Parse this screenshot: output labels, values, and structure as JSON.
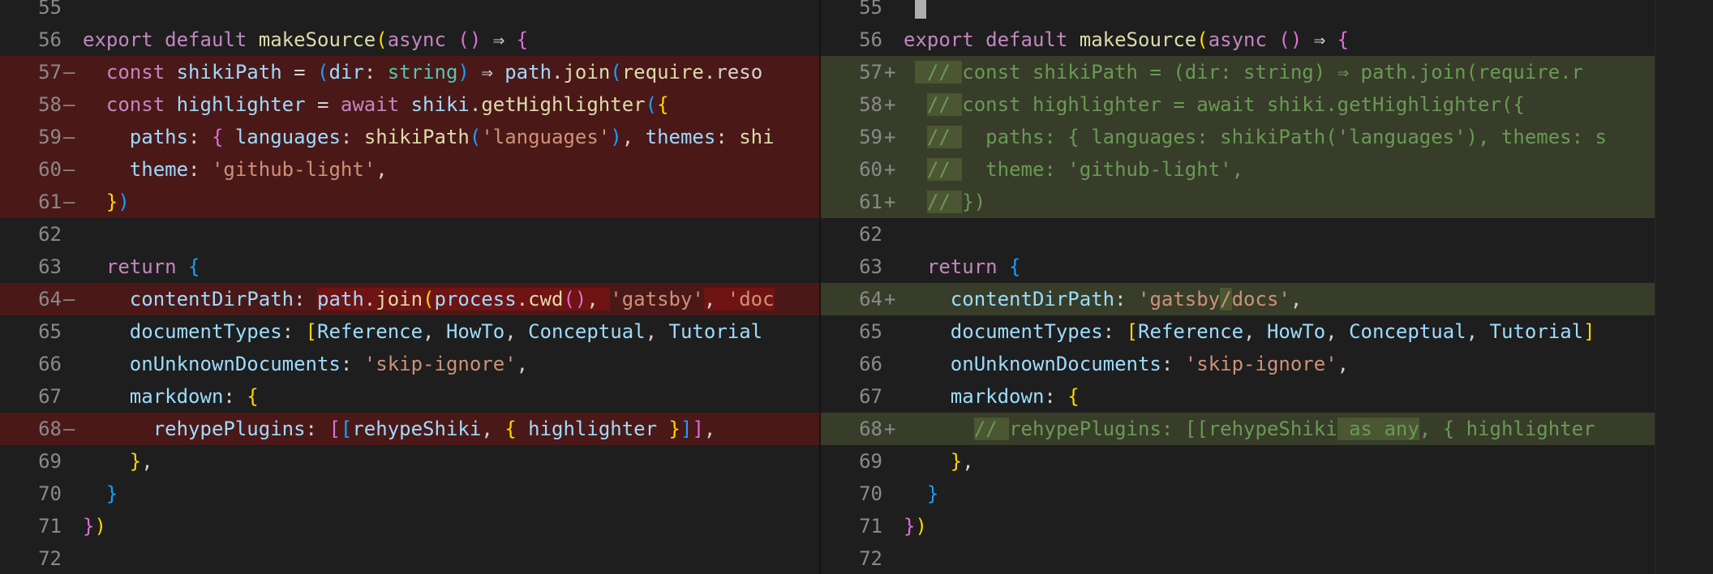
{
  "left": {
    "lines": [
      {
        "num": "55",
        "marker": "",
        "tokens": []
      },
      {
        "num": "56",
        "marker": "",
        "tokens": [
          {
            "t": "export default ",
            "c": "k"
          },
          {
            "t": "makeSource",
            "c": "f"
          },
          {
            "t": "(",
            "c": "b1"
          },
          {
            "t": "async ",
            "c": "k"
          },
          {
            "t": "()",
            "c": "b2"
          },
          {
            "t": " ⇒ ",
            "c": "p"
          },
          {
            "t": "{",
            "c": "b2"
          }
        ]
      },
      {
        "num": "57",
        "marker": "—",
        "type": "removed",
        "tokens": [
          {
            "t": "  const ",
            "c": "k"
          },
          {
            "t": "shikiPath",
            "c": "v"
          },
          {
            "t": " = ",
            "c": "p"
          },
          {
            "t": "(",
            "c": "b3"
          },
          {
            "t": "dir",
            "c": "v"
          },
          {
            "t": ": ",
            "c": "p"
          },
          {
            "t": "string",
            "c": "t"
          },
          {
            "t": ")",
            "c": "b3"
          },
          {
            "t": " ⇒ ",
            "c": "p"
          },
          {
            "t": "path",
            "c": "v"
          },
          {
            "t": ".",
            "c": "p"
          },
          {
            "t": "join",
            "c": "f"
          },
          {
            "t": "(",
            "c": "b3"
          },
          {
            "t": "require",
            "c": "f"
          },
          {
            "t": ".reso",
            "c": "p"
          }
        ]
      },
      {
        "num": "58",
        "marker": "—",
        "type": "removed",
        "tokens": [
          {
            "t": "  const ",
            "c": "k"
          },
          {
            "t": "highlighter",
            "c": "v"
          },
          {
            "t": " = ",
            "c": "p"
          },
          {
            "t": "await ",
            "c": "k"
          },
          {
            "t": "shiki",
            "c": "v"
          },
          {
            "t": ".",
            "c": "p"
          },
          {
            "t": "getHighlighter",
            "c": "f"
          },
          {
            "t": "(",
            "c": "b3"
          },
          {
            "t": "{",
            "c": "b1"
          }
        ]
      },
      {
        "num": "59",
        "marker": "—",
        "type": "removed",
        "tokens": [
          {
            "t": "    paths",
            "c": "v"
          },
          {
            "t": ": ",
            "c": "p"
          },
          {
            "t": "{ ",
            "c": "b2"
          },
          {
            "t": "languages",
            "c": "v"
          },
          {
            "t": ": ",
            "c": "p"
          },
          {
            "t": "shikiPath",
            "c": "f"
          },
          {
            "t": "(",
            "c": "b3"
          },
          {
            "t": "'languages'",
            "c": "s"
          },
          {
            "t": ")",
            "c": "b3"
          },
          {
            "t": ", ",
            "c": "p"
          },
          {
            "t": "themes",
            "c": "v"
          },
          {
            "t": ": ",
            "c": "p"
          },
          {
            "t": "shi",
            "c": "f"
          }
        ]
      },
      {
        "num": "60",
        "marker": "—",
        "type": "removed",
        "tokens": [
          {
            "t": "    theme",
            "c": "v"
          },
          {
            "t": ": ",
            "c": "p"
          },
          {
            "t": "'github-light'",
            "c": "s"
          },
          {
            "t": ",",
            "c": "p"
          }
        ]
      },
      {
        "num": "61",
        "marker": "—",
        "type": "removed",
        "tokens": [
          {
            "t": "  }",
            "c": "b1"
          },
          {
            "t": ")",
            "c": "b3"
          }
        ]
      },
      {
        "num": "62",
        "marker": "",
        "tokens": []
      },
      {
        "num": "63",
        "marker": "",
        "tokens": [
          {
            "t": "  return ",
            "c": "k"
          },
          {
            "t": "{",
            "c": "b3"
          }
        ]
      },
      {
        "num": "64",
        "marker": "—",
        "type": "removed",
        "tokens": [
          {
            "t": "    contentDirPath",
            "c": "v"
          },
          {
            "t": ": ",
            "c": "p"
          },
          {
            "t": "path",
            "c": "v",
            "h": 1
          },
          {
            "t": ".",
            "c": "p",
            "h": 1
          },
          {
            "t": "join",
            "c": "f",
            "h": 1
          },
          {
            "t": "(",
            "c": "b1",
            "h": 1
          },
          {
            "t": "process",
            "c": "v",
            "h": 1
          },
          {
            "t": ".",
            "c": "p",
            "h": 1
          },
          {
            "t": "cwd",
            "c": "f",
            "h": 1
          },
          {
            "t": "()",
            "c": "b2",
            "h": 1
          },
          {
            "t": ", ",
            "c": "p",
            "h": 1
          },
          {
            "t": "'gatsby'",
            "c": "s"
          },
          {
            "t": ", ",
            "c": "p",
            "h": 1
          },
          {
            "t": "'doc",
            "c": "s",
            "h": 1
          }
        ]
      },
      {
        "num": "65",
        "marker": "",
        "tokens": [
          {
            "t": "    documentTypes",
            "c": "v"
          },
          {
            "t": ": ",
            "c": "p"
          },
          {
            "t": "[",
            "c": "b1"
          },
          {
            "t": "Reference",
            "c": "v"
          },
          {
            "t": ", ",
            "c": "p"
          },
          {
            "t": "HowTo",
            "c": "v"
          },
          {
            "t": ", ",
            "c": "p"
          },
          {
            "t": "Conceptual",
            "c": "v"
          },
          {
            "t": ", ",
            "c": "p"
          },
          {
            "t": "Tutorial",
            "c": "v"
          }
        ]
      },
      {
        "num": "66",
        "marker": "",
        "tokens": [
          {
            "t": "    onUnknownDocuments",
            "c": "v"
          },
          {
            "t": ": ",
            "c": "p"
          },
          {
            "t": "'skip-ignore'",
            "c": "s"
          },
          {
            "t": ",",
            "c": "p"
          }
        ]
      },
      {
        "num": "67",
        "marker": "",
        "tokens": [
          {
            "t": "    markdown",
            "c": "v"
          },
          {
            "t": ": ",
            "c": "p"
          },
          {
            "t": "{",
            "c": "b1"
          }
        ]
      },
      {
        "num": "68",
        "marker": "—",
        "type": "removed",
        "tokens": [
          {
            "t": "      rehypePlugins",
            "c": "v"
          },
          {
            "t": ": ",
            "c": "p"
          },
          {
            "t": "[",
            "c": "b2"
          },
          {
            "t": "[",
            "c": "b3"
          },
          {
            "t": "rehypeShiki",
            "c": "v"
          },
          {
            "t": ", ",
            "c": "p"
          },
          {
            "t": "{ ",
            "c": "b1"
          },
          {
            "t": "highlighter",
            "c": "v"
          },
          {
            "t": " }",
            "c": "b1"
          },
          {
            "t": "]",
            "c": "b3"
          },
          {
            "t": "]",
            "c": "b2"
          },
          {
            "t": ",",
            "c": "p"
          }
        ]
      },
      {
        "num": "69",
        "marker": "",
        "tokens": [
          {
            "t": "    }",
            "c": "b1"
          },
          {
            "t": ",",
            "c": "p"
          }
        ]
      },
      {
        "num": "70",
        "marker": "",
        "tokens": [
          {
            "t": "  }",
            "c": "b3"
          }
        ]
      },
      {
        "num": "71",
        "marker": "",
        "tokens": [
          {
            "t": "}",
            "c": "b2"
          },
          {
            "t": ")",
            "c": "b1"
          }
        ]
      },
      {
        "num": "72",
        "marker": "",
        "tokens": []
      }
    ]
  },
  "right": {
    "lines": [
      {
        "num": "55",
        "marker": "",
        "cursor": true,
        "tokens": []
      },
      {
        "num": "56",
        "marker": "",
        "tokens": [
          {
            "t": "export default ",
            "c": "k"
          },
          {
            "t": "makeSource",
            "c": "f"
          },
          {
            "t": "(",
            "c": "b1"
          },
          {
            "t": "async ",
            "c": "k"
          },
          {
            "t": "()",
            "c": "b2"
          },
          {
            "t": " ⇒ ",
            "c": "p"
          },
          {
            "t": "{",
            "c": "b2"
          }
        ]
      },
      {
        "num": "57",
        "marker": "+",
        "type": "added",
        "tokens": [
          {
            "t": " ",
            "c": "p"
          },
          {
            "t": " // ",
            "c": "c",
            "h": 1
          },
          {
            "t": "const shikiPath = (dir: string) ⇒ path.join(require.r",
            "c": "c"
          }
        ]
      },
      {
        "num": "58",
        "marker": "+",
        "type": "added",
        "tokens": [
          {
            "t": "  ",
            "c": "p"
          },
          {
            "t": "// ",
            "c": "c",
            "h": 1
          },
          {
            "t": "const highlighter = await shiki.getHighlighter({",
            "c": "c"
          }
        ]
      },
      {
        "num": "59",
        "marker": "+",
        "type": "added",
        "tokens": [
          {
            "t": "  ",
            "c": "p"
          },
          {
            "t": "// ",
            "c": "c",
            "h": 1
          },
          {
            "t": "  paths: { languages: shikiPath('languages'), themes: s",
            "c": "c"
          }
        ]
      },
      {
        "num": "60",
        "marker": "+",
        "type": "added",
        "tokens": [
          {
            "t": "  ",
            "c": "p"
          },
          {
            "t": "// ",
            "c": "c",
            "h": 1
          },
          {
            "t": "  theme: 'github-light',",
            "c": "c"
          }
        ]
      },
      {
        "num": "61",
        "marker": "+",
        "type": "added",
        "tokens": [
          {
            "t": "  ",
            "c": "p"
          },
          {
            "t": "// ",
            "c": "c",
            "h": 1
          },
          {
            "t": "})",
            "c": "c"
          }
        ]
      },
      {
        "num": "62",
        "marker": "",
        "tokens": []
      },
      {
        "num": "63",
        "marker": "",
        "tokens": [
          {
            "t": "  return ",
            "c": "k"
          },
          {
            "t": "{",
            "c": "b3"
          }
        ]
      },
      {
        "num": "64",
        "marker": "+",
        "type": "added",
        "tokens": [
          {
            "t": "    contentDirPath",
            "c": "v"
          },
          {
            "t": ": ",
            "c": "p"
          },
          {
            "t": "'gatsby",
            "c": "s"
          },
          {
            "t": "/",
            "c": "s",
            "h": 1
          },
          {
            "t": "docs'",
            "c": "s"
          },
          {
            "t": ",",
            "c": "p"
          }
        ]
      },
      {
        "num": "65",
        "marker": "",
        "tokens": [
          {
            "t": "    documentTypes",
            "c": "v"
          },
          {
            "t": ": ",
            "c": "p"
          },
          {
            "t": "[",
            "c": "b1"
          },
          {
            "t": "Reference",
            "c": "v"
          },
          {
            "t": ", ",
            "c": "p"
          },
          {
            "t": "HowTo",
            "c": "v"
          },
          {
            "t": ", ",
            "c": "p"
          },
          {
            "t": "Conceptual",
            "c": "v"
          },
          {
            "t": ", ",
            "c": "p"
          },
          {
            "t": "Tutorial",
            "c": "v"
          },
          {
            "t": "]",
            "c": "b1"
          }
        ]
      },
      {
        "num": "66",
        "marker": "",
        "tokens": [
          {
            "t": "    onUnknownDocuments",
            "c": "v"
          },
          {
            "t": ": ",
            "c": "p"
          },
          {
            "t": "'skip-ignore'",
            "c": "s"
          },
          {
            "t": ",",
            "c": "p"
          }
        ]
      },
      {
        "num": "67",
        "marker": "",
        "tokens": [
          {
            "t": "    markdown",
            "c": "v"
          },
          {
            "t": ": ",
            "c": "p"
          },
          {
            "t": "{",
            "c": "b1"
          }
        ]
      },
      {
        "num": "68",
        "marker": "+",
        "type": "added",
        "tokens": [
          {
            "t": "      ",
            "c": "p"
          },
          {
            "t": "// ",
            "c": "c",
            "h": 1
          },
          {
            "t": "rehypePlugins: [[rehypeShiki",
            "c": "c"
          },
          {
            "t": " as any",
            "c": "c",
            "h": 1
          },
          {
            "t": ", { highlighter",
            "c": "c"
          }
        ]
      },
      {
        "num": "69",
        "marker": "",
        "tokens": [
          {
            "t": "    }",
            "c": "b1"
          },
          {
            "t": ",",
            "c": "p"
          }
        ]
      },
      {
        "num": "70",
        "marker": "",
        "tokens": [
          {
            "t": "  }",
            "c": "b3"
          }
        ]
      },
      {
        "num": "71",
        "marker": "",
        "tokens": [
          {
            "t": "}",
            "c": "b2"
          },
          {
            "t": ")",
            "c": "b1"
          }
        ]
      },
      {
        "num": "72",
        "marker": "",
        "tokens": []
      }
    ]
  }
}
